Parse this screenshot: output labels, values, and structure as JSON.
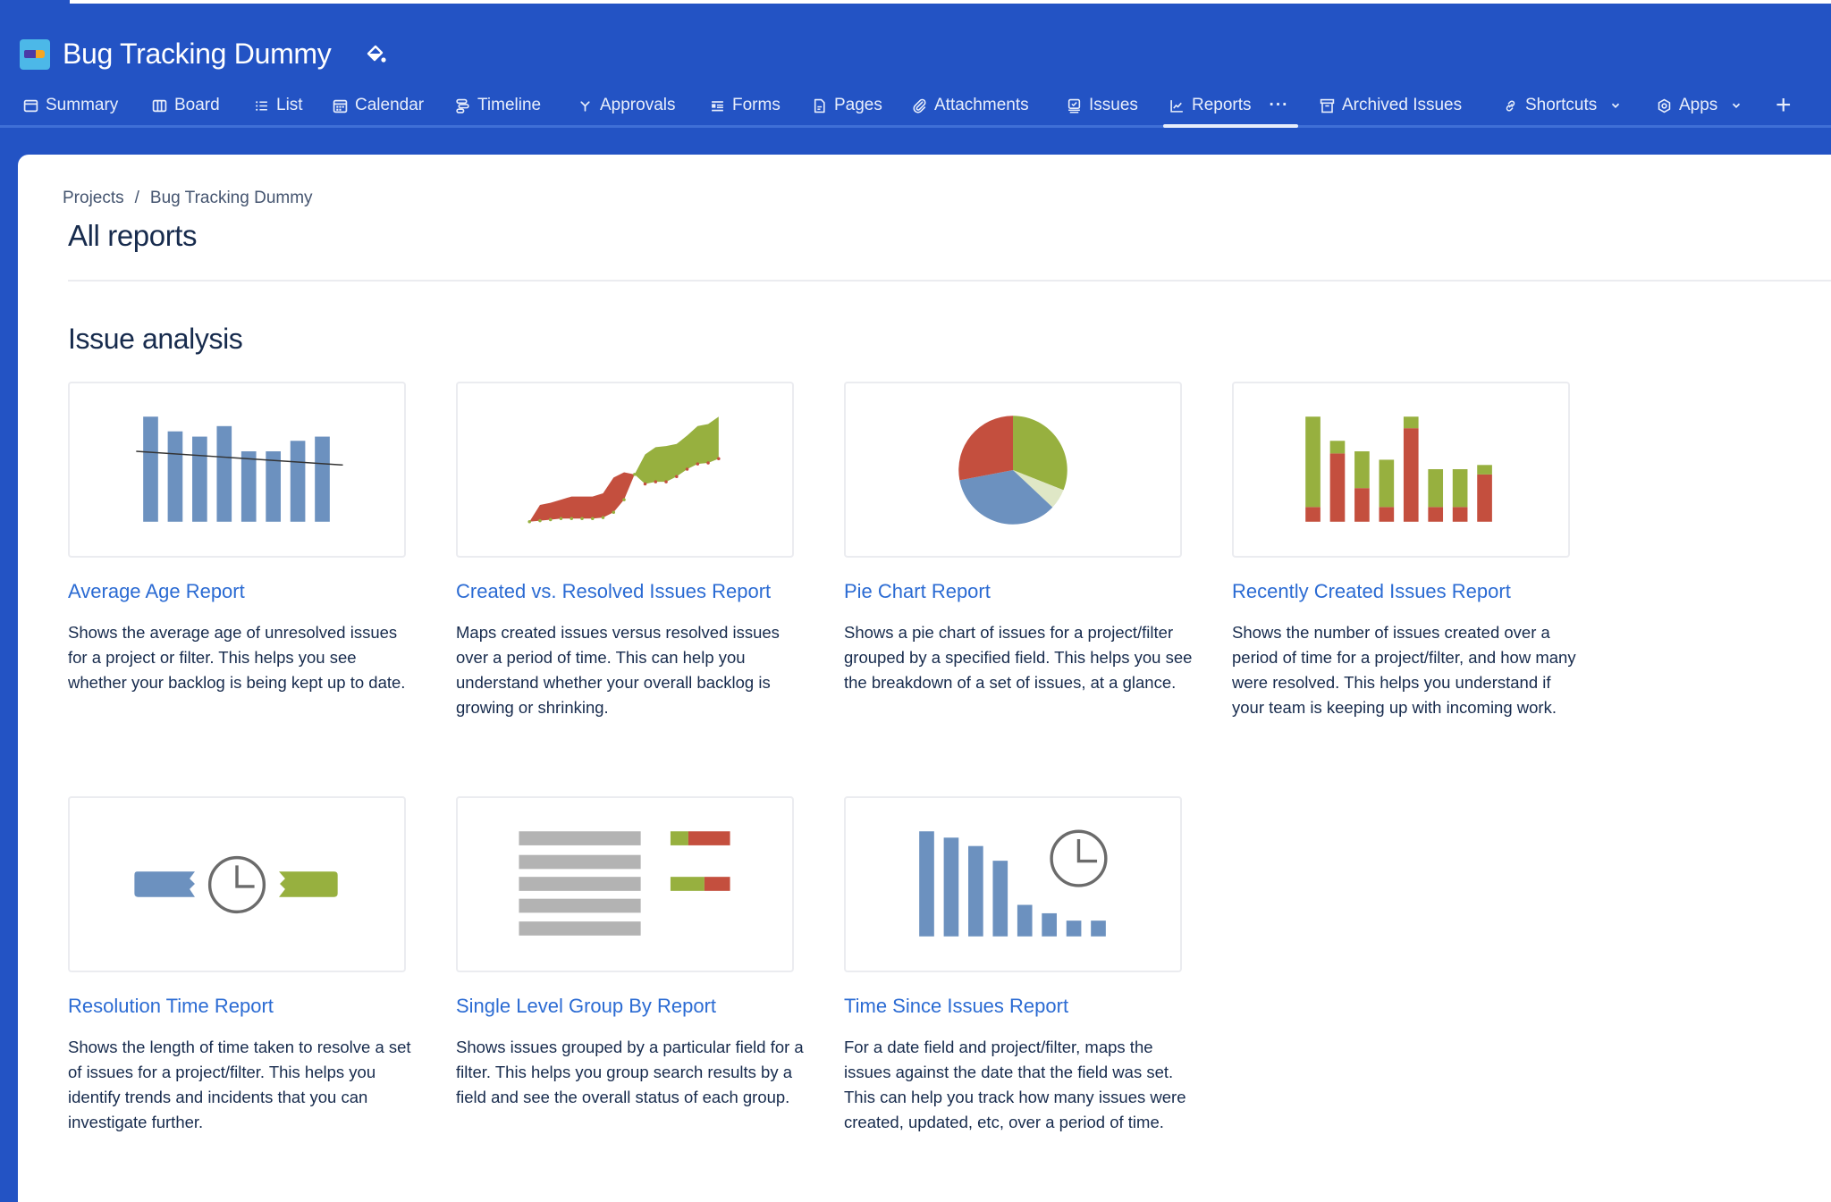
{
  "project": {
    "title": "Bug Tracking Dummy",
    "icon": "project-avatar-icon",
    "theme_icon": "paint-bucket-icon"
  },
  "nav": {
    "items": [
      {
        "label": "Summary",
        "icon": "summary-icon"
      },
      {
        "label": "Board",
        "icon": "board-icon"
      },
      {
        "label": "List",
        "icon": "list-icon"
      },
      {
        "label": "Calendar",
        "icon": "calendar-icon"
      },
      {
        "label": "Timeline",
        "icon": "timeline-icon"
      },
      {
        "label": "Approvals",
        "icon": "approvals-icon"
      },
      {
        "label": "Forms",
        "icon": "forms-icon"
      },
      {
        "label": "Pages",
        "icon": "pages-icon"
      },
      {
        "label": "Attachments",
        "icon": "paperclip-icon"
      },
      {
        "label": "Issues",
        "icon": "issues-icon"
      },
      {
        "label": "Reports",
        "icon": "reports-icon",
        "active": true
      },
      {
        "label": "Archived Issues",
        "icon": "archive-icon"
      },
      {
        "label": "Shortcuts",
        "icon": "link-icon",
        "dropdown": true
      },
      {
        "label": "Apps",
        "icon": "apps-icon",
        "dropdown": true
      }
    ],
    "more_label": "···",
    "add_label": "+"
  },
  "breadcrumb": {
    "items": [
      "Projects",
      "Bug Tracking Dummy"
    ],
    "separator": "/"
  },
  "page": {
    "title": "All reports",
    "section_title": "Issue analysis"
  },
  "colors": {
    "header_bg": "#2353c4",
    "link": "#2b6bd3",
    "chart_blue": "#6c91bf",
    "chart_green": "#97b03f",
    "chart_red": "#c44f3e",
    "chart_gray": "#b3b3b3"
  },
  "reports": [
    {
      "title": "Average Age Report",
      "description": "Shows the average age of unresolved issues for a project or filter. This helps you see whether your backlog is being kept up to date.",
      "thumbnail": "average-age-bar-chart"
    },
    {
      "title": "Created vs. Resolved Issues Report",
      "description": "Maps created issues versus resolved issues over a period of time. This can help you understand whether your overall backlog is growing or shrinking.",
      "thumbnail": "created-vs-resolved-area-chart"
    },
    {
      "title": "Pie Chart Report",
      "description": "Shows a pie chart of issues for a project/filter grouped by a specified field. This helps you see the breakdown of a set of issues, at a glance.",
      "thumbnail": "pie-chart"
    },
    {
      "title": "Recently Created Issues Report",
      "description": "Shows the number of issues created over a period of time for a project/filter, and how many were resolved. This helps you understand if your team is keeping up with incoming work.",
      "thumbnail": "stacked-bar-chart"
    },
    {
      "title": "Resolution Time Report",
      "description": "Shows the length of time taken to resolve a set of issues for a project/filter. This helps you identify trends and incidents that you can investigate further.",
      "thumbnail": "resolution-time-illustration"
    },
    {
      "title": "Single Level Group By Report",
      "description": "Shows issues grouped by a particular field for a filter. This helps you group search results by a field and see the overall status of each group.",
      "thumbnail": "group-by-illustration"
    },
    {
      "title": "Time Since Issues Report",
      "description": "For a date field and project/filter, maps the issues against the date that the field was set. This can help you track how many issues were created, updated, etc, over a period of time.",
      "thumbnail": "time-since-bar-chart"
    }
  ],
  "thumbnails": {
    "average_age": {
      "values": [
        1.0,
        0.86,
        0.81,
        0.91,
        0.67,
        0.67,
        0.77,
        0.81
      ],
      "trend": [
        0.67,
        0.54
      ]
    },
    "created_vs_resolved": {
      "created": [
        0.0,
        0.16,
        0.18,
        0.21,
        0.24,
        0.24,
        0.24,
        0.27,
        0.42,
        0.47,
        0.45,
        0.64,
        0.71,
        0.72,
        0.74,
        0.82,
        0.91,
        0.93,
        1.0
      ],
      "resolved": [
        0.0,
        0.01,
        0.02,
        0.03,
        0.03,
        0.03,
        0.03,
        0.04,
        0.09,
        0.21,
        0.45,
        0.36,
        0.38,
        0.38,
        0.43,
        0.5,
        0.55,
        0.56,
        0.6
      ]
    },
    "pie": {
      "slices": [
        {
          "label": "green",
          "value": 0.31
        },
        {
          "label": "light-green",
          "value": 0.06
        },
        {
          "label": "blue",
          "value": 0.35
        },
        {
          "label": "red",
          "value": 0.28
        }
      ]
    },
    "recently_created": {
      "resolved": [
        0.14,
        0.65,
        0.32,
        0.14,
        0.89,
        0.14,
        0.14,
        0.45
      ],
      "created_extra": [
        0.86,
        0.12,
        0.35,
        0.45,
        0.11,
        0.36,
        0.36,
        0.09
      ]
    },
    "group_by": {
      "rows": 5,
      "status_bars": [
        {
          "green": 0.3,
          "red": 0.7
        },
        {
          "green": 0.57,
          "red": 0.43
        }
      ]
    },
    "time_since": {
      "values": [
        1.0,
        0.94,
        0.86,
        0.72,
        0.3,
        0.22,
        0.15,
        0.15
      ]
    }
  }
}
